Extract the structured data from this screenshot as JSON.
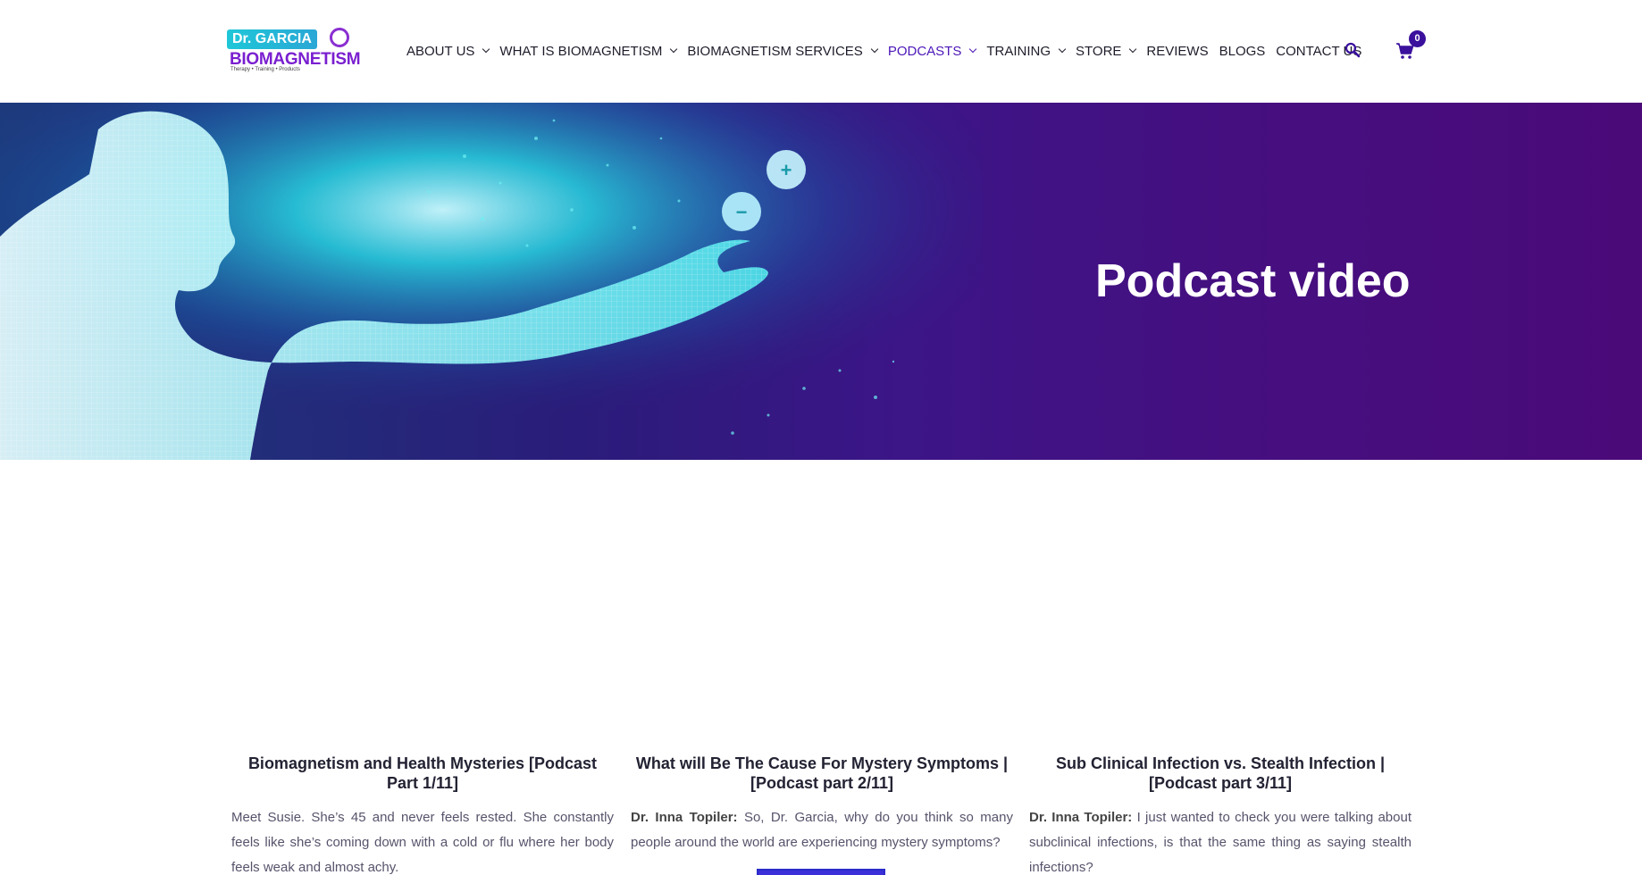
{
  "logo": {
    "dr_text": "Dr. GARCIA",
    "brand_text": "BIOMAGNETISM",
    "tagline": "Therapy • Training • Products"
  },
  "nav": {
    "items": [
      {
        "label": "ABOUT US",
        "dropdown": true
      },
      {
        "label": "WHAT IS BIOMAGNETISM",
        "dropdown": true
      },
      {
        "label": "BIOMAGNETISM SERVICES",
        "dropdown": true
      },
      {
        "label": "PODCASTS",
        "dropdown": true,
        "active": true
      },
      {
        "label": "TRAINING",
        "dropdown": true
      },
      {
        "label": "STORE",
        "dropdown": true
      },
      {
        "label": "REVIEWS",
        "dropdown": false
      },
      {
        "label": "BLOGS",
        "dropdown": false
      },
      {
        "label": "CONTACT US",
        "dropdown": false
      }
    ],
    "search_icon": "search-icon",
    "cart_icon": "cart-icon",
    "cart_count": "0"
  },
  "hero": {
    "title": "Podcast video",
    "plus_symbol": "+",
    "minus_symbol": "−"
  },
  "posts": [
    {
      "title": "Biomagnetism and Health Mysteries [Podcast Part 1/11]",
      "speaker": "",
      "excerpt": "Meet Susie. She’s 45 and never feels rested. She constantly feels like she’s coming down with a cold or flu where her body feels weak and almost achy."
    },
    {
      "title": "What will Be The Cause For Mystery Symptoms | [Podcast part 2/11]",
      "speaker": "Dr. Inna Topiler:",
      "excerpt": "So, Dr. Garcia, why do you think so many people around the world are experiencing mystery symptoms?"
    },
    {
      "title": "Sub Clinical Infection vs. Stealth Infection | [Podcast part 3/11]",
      "speaker": "Dr. Inna Topiler:",
      "excerpt": "I just wanted to check you were talking about subclinical infections, is that the same thing as saying stealth infections?"
    }
  ],
  "colors": {
    "accent": "#4b16b8",
    "badge": "#3a109c",
    "hero_bg": "#450f80",
    "text": "#57536b"
  }
}
